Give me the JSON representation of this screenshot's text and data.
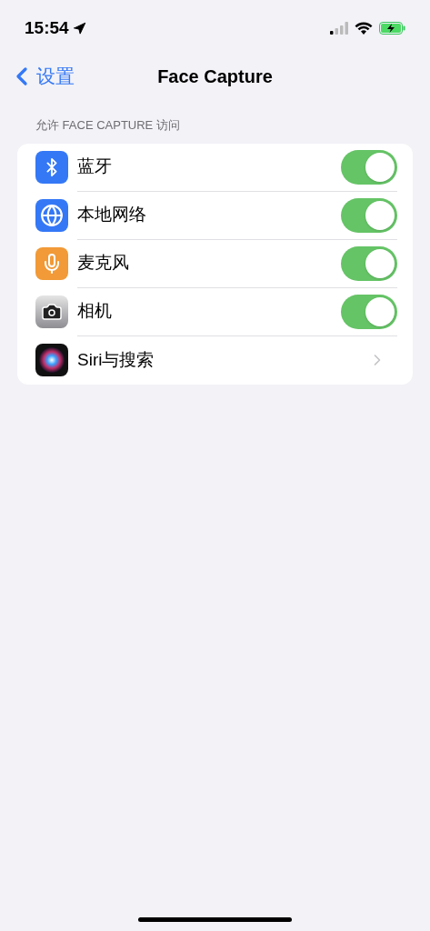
{
  "status_bar": {
    "time": "15:54"
  },
  "nav": {
    "back": "设置",
    "title": "Face Capture"
  },
  "section": {
    "header": "允许 FACE CAPTURE 访问",
    "rows": [
      {
        "kind": "toggle",
        "label": "蓝牙",
        "on": true
      },
      {
        "kind": "toggle",
        "label": "本地网络",
        "on": true
      },
      {
        "kind": "toggle",
        "label": "麦克风",
        "on": true
      },
      {
        "kind": "toggle",
        "label": "相机",
        "on": true
      },
      {
        "kind": "link",
        "label": "Siri与搜索"
      }
    ]
  }
}
